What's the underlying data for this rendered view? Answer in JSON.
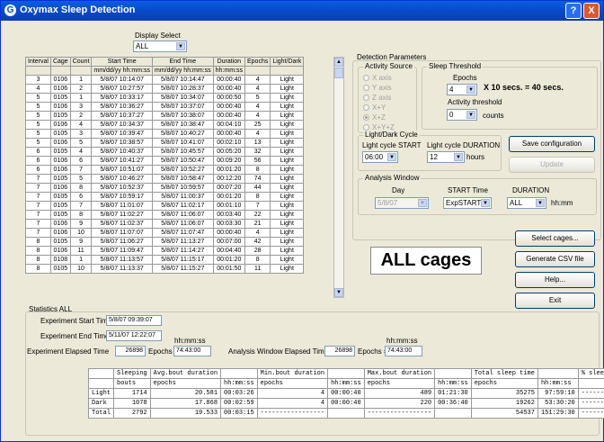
{
  "window": {
    "title": "Oxymax Sleep Detection",
    "help_glyph": "?",
    "close_glyph": "X",
    "app_icon_glyph": "G"
  },
  "display_select": {
    "label": "Display Select",
    "value": "ALL"
  },
  "grid": {
    "head1": [
      "Interval",
      "Cage",
      "Count",
      "Start Time",
      "End Time",
      "Duration",
      "Epochs",
      "Light/Dark"
    ],
    "head2": [
      "",
      "",
      "",
      "mm/dd/yy hh:mm:ss",
      "mm/dd/yy hh:mm:ss",
      "hh:mm:ss",
      "",
      ""
    ],
    "rows": [
      [
        "3",
        "0106",
        "1",
        "5/8/07 10:14:07",
        "5/8/07 10:14:47",
        "00:00:40",
        "4",
        "Light"
      ],
      [
        "4",
        "0106",
        "2",
        "5/8/07 10:27:57",
        "5/8/07 10:28:37",
        "00:00:40",
        "4",
        "Light"
      ],
      [
        "5",
        "0105",
        "1",
        "5/8/07 10:33:17",
        "5/8/07 10:34:07",
        "00:00:50",
        "5",
        "Light"
      ],
      [
        "5",
        "0106",
        "3",
        "5/8/07 10:36:27",
        "5/8/07 10:37:07",
        "00:00:40",
        "4",
        "Light"
      ],
      [
        "5",
        "0105",
        "2",
        "5/8/07 10:37:27",
        "5/8/07 10:38:07",
        "00:00:40",
        "4",
        "Light"
      ],
      [
        "5",
        "0106",
        "4",
        "5/8/07 10:34:37",
        "5/8/07 10:38:47",
        "00:04:10",
        "25",
        "Light"
      ],
      [
        "5",
        "0105",
        "3",
        "5/8/07 10:39:47",
        "5/8/07 10:40:27",
        "00:00:40",
        "4",
        "Light"
      ],
      [
        "5",
        "0106",
        "5",
        "5/8/07 10:38:57",
        "5/8/07 10:41:07",
        "00:02:10",
        "13",
        "Light"
      ],
      [
        "6",
        "0105",
        "4",
        "5/8/07 10:40:37",
        "5/8/07 10:45:57",
        "00:05:20",
        "32",
        "Light"
      ],
      [
        "6",
        "0106",
        "6",
        "5/8/07 10:41:27",
        "5/8/07 10:50:47",
        "00:09:20",
        "56",
        "Light"
      ],
      [
        "6",
        "0106",
        "7",
        "5/8/07 10:51:07",
        "5/8/07 10:52:27",
        "00:01:20",
        "8",
        "Light"
      ],
      [
        "7",
        "0105",
        "5",
        "5/8/07 10:46:27",
        "5/8/07 10:58:47",
        "00:12:20",
        "74",
        "Light"
      ],
      [
        "7",
        "0106",
        "8",
        "5/8/07 10:52:37",
        "5/8/07 10:59:57",
        "00:07:20",
        "44",
        "Light"
      ],
      [
        "7",
        "0105",
        "6",
        "5/8/07 10:59:17",
        "5/8/07 11:00:37",
        "00:01:20",
        "8",
        "Light"
      ],
      [
        "7",
        "0105",
        "7",
        "5/8/07 11:01:07",
        "5/8/07 11:02:17",
        "00:01:10",
        "7",
        "Light"
      ],
      [
        "7",
        "0105",
        "8",
        "5/8/07 11:02:27",
        "5/8/07 11:06:07",
        "00:03:40",
        "22",
        "Light"
      ],
      [
        "7",
        "0106",
        "9",
        "5/8/07 11:02:37",
        "5/8/07 11:06:07",
        "00:03:30",
        "21",
        "Light"
      ],
      [
        "7",
        "0106",
        "10",
        "5/8/07 11:07:07",
        "5/8/07 11:07:47",
        "00:00:40",
        "4",
        "Light"
      ],
      [
        "8",
        "0105",
        "9",
        "5/8/07 11:06:27",
        "5/8/07 11:13:27",
        "00:07:00",
        "42",
        "Light"
      ],
      [
        "8",
        "0106",
        "11",
        "5/8/07 11:09:47",
        "5/8/07 11:14:27",
        "00:04:40",
        "28",
        "Light"
      ],
      [
        "8",
        "0108",
        "1",
        "5/8/07 11:13:57",
        "5/8/07 11:15:17",
        "00:01:20",
        "8",
        "Light"
      ],
      [
        "8",
        "0105",
        "10",
        "5/8/07 11:13:37",
        "5/8/07 11:15:27",
        "00:01:50",
        "11",
        "Light"
      ]
    ]
  },
  "detection": {
    "title": "Detection Parameters",
    "activity_source": {
      "title": "Activity Source",
      "options": [
        "X axis",
        "Y axis",
        "Z axis",
        "X+Y",
        "X+Z",
        "X+Y+Z"
      ],
      "selected": "X+Z"
    },
    "sleep_threshold": {
      "title": "Sleep Threshold",
      "epochs_label": "Epochs",
      "epochs_value": "4",
      "multiplier_text": "X 10 secs. = 40 secs.",
      "activity_label": "Activity threshold",
      "activity_value": "0",
      "counts_label": "counts"
    },
    "light_dark": {
      "title": "Light/Dark Cycle",
      "start_label": "Light cycle START",
      "start_value": "06:00",
      "duration_label": "Light cycle DURATION",
      "duration_value": "12",
      "hours_label": "hours"
    },
    "analysis": {
      "title": "Analysis Window",
      "day_label": "Day",
      "day_value": "5/8/07",
      "start_label": "START Time",
      "start_value": "ExpSTART",
      "duration_label": "DURATION",
      "duration_value": "ALL",
      "unit_label": "hh:mm"
    }
  },
  "buttons": {
    "save": "Save configuration",
    "update": "Update",
    "select_cages": "Select cages...",
    "csv": "Generate CSV file",
    "help": "Help...",
    "exit": "Exit"
  },
  "big_label": "ALL cages",
  "stats": {
    "title": "Statistics ALL",
    "exp_start_label": "Experiment Start Time",
    "exp_start_value": "5/8/07 09:39:07",
    "exp_end_label": "Experiment End Time",
    "exp_end_value": "5/11/07 12:22:07",
    "hhmmss_label": "hh:mm:ss",
    "elapsed_label": "Experiment Elapsed Time",
    "elapsed_value": "26898",
    "epochs_eq": "Epochs =",
    "elapsed_hms": "74:43:00",
    "window_label": "Analysis Window Elapsed Time",
    "window_value": "26898",
    "window_hms": "74:43:00",
    "table": {
      "head1": [
        "",
        "Sleeping",
        "Avg.bout duration",
        "",
        "Min.bout duration",
        "",
        "Max.bout duration",
        "",
        "Total sleep time",
        "",
        "% sleeping"
      ],
      "head2": [
        "",
        "bouts",
        "epochs",
        "hh:mm:ss",
        "epochs",
        "hh:mm:ss",
        "epochs",
        "hh:mm:ss",
        "epochs",
        "hh:mm:ss",
        ""
      ],
      "rows": [
        [
          "Light",
          "1714",
          "20.581",
          "00:03:26",
          "4",
          "00:00:40",
          "489",
          "01:21:30",
          "35275",
          "97:59:10",
          "-------------"
        ],
        [
          "Dark",
          "1078",
          "17.868",
          "00:02:59",
          "4",
          "00:00:40",
          "220",
          "00:36:40",
          "19262",
          "53:30:20",
          "-------------"
        ],
        [
          "Total",
          "2792",
          "19.533",
          "00:03:15",
          "-----------------",
          "",
          "-----------------",
          "",
          "54537",
          "151:29:30",
          "-------------"
        ]
      ]
    }
  }
}
